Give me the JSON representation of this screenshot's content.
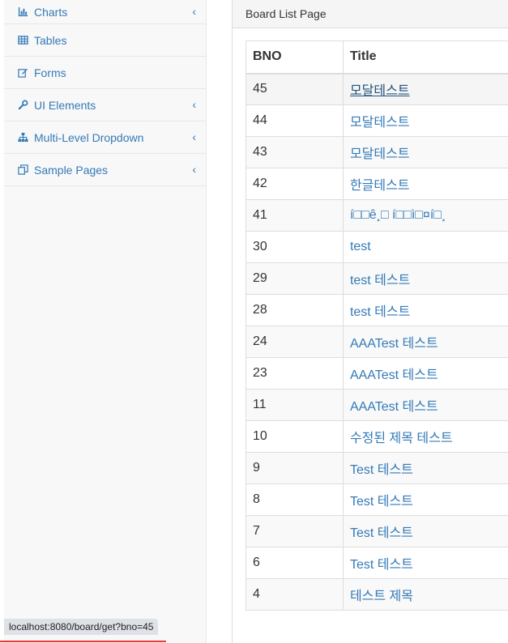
{
  "sidebar": {
    "items": [
      {
        "label": "Charts",
        "icon": "bar-chart-icon",
        "has_arrow": true
      },
      {
        "label": "Tables",
        "icon": "table-icon",
        "has_arrow": false
      },
      {
        "label": "Forms",
        "icon": "edit-icon",
        "has_arrow": false
      },
      {
        "label": "UI Elements",
        "icon": "wrench-icon",
        "has_arrow": true
      },
      {
        "label": "Multi-Level Dropdown",
        "icon": "sitemap-icon",
        "has_arrow": true
      },
      {
        "label": "Sample Pages",
        "icon": "files-icon",
        "has_arrow": true
      }
    ],
    "arrow_glyph": "‹"
  },
  "panel": {
    "heading": "Board List Page"
  },
  "table": {
    "columns": [
      "BNO",
      "Title"
    ],
    "rows": [
      {
        "bno": "45",
        "title": "모달테스트"
      },
      {
        "bno": "44",
        "title": "모달테스트"
      },
      {
        "bno": "43",
        "title": "모달테스트"
      },
      {
        "bno": "42",
        "title": "한글테스트"
      },
      {
        "bno": "41",
        "title": "í□□ê¸□ í□□ì□¤í□¸"
      },
      {
        "bno": "30",
        "title": "test"
      },
      {
        "bno": "29",
        "title": "test 테스트"
      },
      {
        "bno": "28",
        "title": "test 테스트"
      },
      {
        "bno": "24",
        "title": "AAATest 테스트"
      },
      {
        "bno": "23",
        "title": "AAATest 테스트"
      },
      {
        "bno": "11",
        "title": "AAATest 테스트"
      },
      {
        "bno": "10",
        "title": "수정된 제목 테스트"
      },
      {
        "bno": "9",
        "title": "Test 테스트"
      },
      {
        "bno": "8",
        "title": "Test 테스트"
      },
      {
        "bno": "7",
        "title": "Test 테스트"
      },
      {
        "bno": "6",
        "title": "Test 테스트"
      },
      {
        "bno": "4",
        "title": "테스트 제목"
      }
    ]
  },
  "status_bar": {
    "url": "localhost:8080/board/get?bno=45"
  },
  "colors": {
    "link": "#337ab7",
    "accent_line": "#e53935"
  }
}
